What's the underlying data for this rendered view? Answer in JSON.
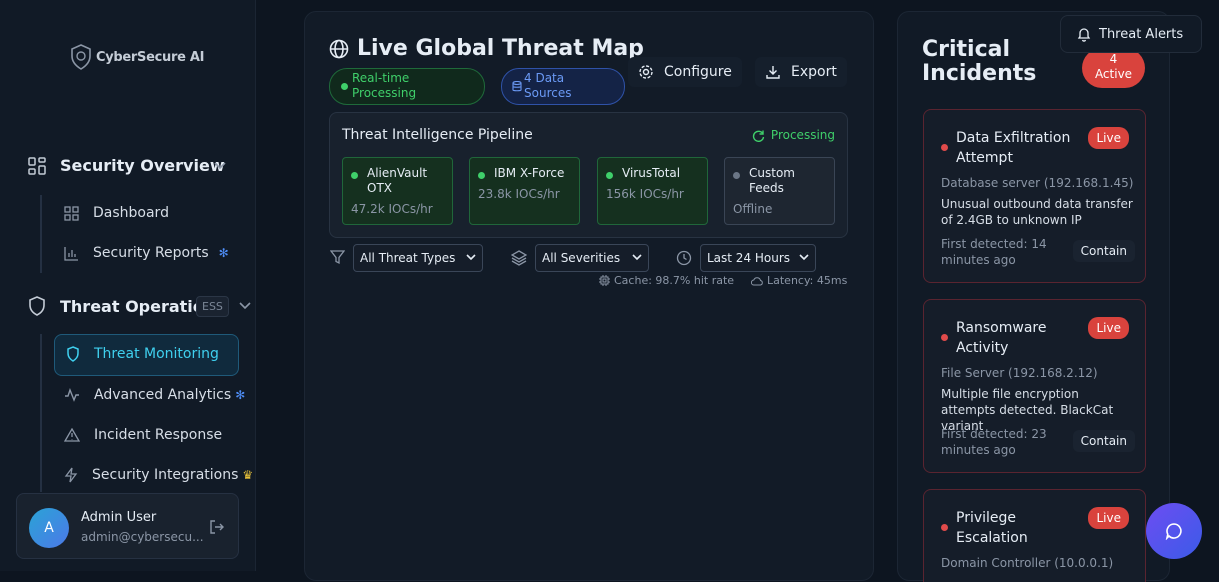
{
  "sidebar": {
    "logo_text": "CyberSecure AI",
    "sections": [
      {
        "label": "Security Overview"
      },
      {
        "label": "Threat Operations",
        "badge": "ESS"
      }
    ],
    "items": [
      {
        "label": "Dashboard"
      },
      {
        "label": "Security Reports"
      },
      {
        "label": "Threat Monitoring"
      },
      {
        "label": "Advanced Analytics"
      },
      {
        "label": "Incident Response"
      },
      {
        "label": "Security Integrations"
      }
    ],
    "user": {
      "initial": "A",
      "name": "Admin User",
      "email": "admin@cybersecu..."
    }
  },
  "main": {
    "title": "Live Global Threat Map",
    "badges": [
      "Real-time Processing",
      "4 Data Sources"
    ],
    "configure_label": "Configure",
    "export_label": "Export",
    "pipeline": {
      "title": "Threat Intelligence Pipeline",
      "status": "Processing",
      "sources": [
        {
          "name": "AlienVault OTX",
          "rate": "47.2k IOCs/hr",
          "status": "online"
        },
        {
          "name": "IBM X-Force",
          "rate": "23.8k IOCs/hr",
          "status": "online"
        },
        {
          "name": "VirusTotal",
          "rate": "156k IOCs/hr",
          "status": "online"
        },
        {
          "name": "Custom Feeds",
          "rate": "Offline",
          "status": "offline"
        }
      ]
    },
    "filters": {
      "threat_type": "All Threat Types",
      "severity": "All Severities",
      "time_range": "Last 24 Hours"
    },
    "cache": "Cache: 98.7% hit rate",
    "latency": "Latency: 45ms"
  },
  "incidents": {
    "title": "Critical Incidents",
    "active_count": "4",
    "active_label": "Active",
    "live_label": "Live",
    "items": [
      {
        "title": "Data Exfiltration Attempt",
        "host": "Database server (192.168.1.45)",
        "description": "Unusual outbound data transfer of 2.4GB to unknown IP",
        "first_detected": "First detected: 14 minutes ago",
        "action": "Contain"
      },
      {
        "title": "Ransomware Activity",
        "host": "File Server (192.168.2.12)",
        "description": "Multiple file encryption attempts detected. BlackCat variant",
        "first_detected": "First detected: 23 minutes ago",
        "action": "Contain"
      },
      {
        "title": "Privilege Escalation",
        "host": "Domain Controller (10.0.0.1)",
        "description": "",
        "first_detected": "",
        "action": ""
      }
    ]
  },
  "header": {
    "alerts_label": "Threat Alerts"
  },
  "colors": {
    "accent": "#29c1e8",
    "danger": "#d9433d",
    "success": "#3fcf6a",
    "info": "#5b8cf0"
  }
}
